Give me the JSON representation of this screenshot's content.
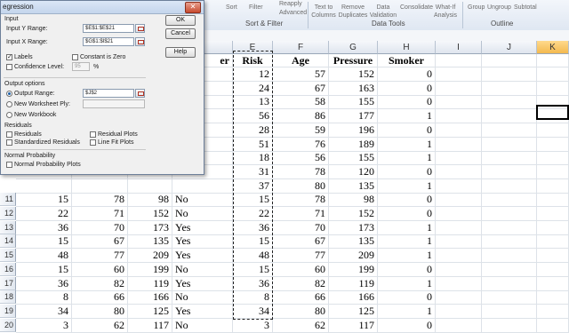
{
  "ribbon": {
    "items": [
      "Sort",
      "Filter",
      "Reapply",
      "Advanced",
      "Text to Columns",
      "Remove Duplicates",
      "Data Validation",
      "Consolidate",
      "What-If Analysis",
      "Group",
      "Ungroup",
      "Subtotal"
    ],
    "groups": [
      "Sort & Filter",
      "Data Tools",
      "Outline"
    ]
  },
  "columns": [
    "E",
    "F",
    "G",
    "H",
    "I",
    "J",
    "K"
  ],
  "rows": [
    {
      "n": "",
      "a": "",
      "b": "",
      "c": "",
      "d": "",
      "e": "12",
      "f": "57",
      "g": "152",
      "h": "0"
    },
    {
      "n": "",
      "a": "",
      "b": "",
      "c": "",
      "d": "",
      "e": "24",
      "f": "67",
      "g": "163",
      "h": "0"
    },
    {
      "n": "",
      "a": "",
      "b": "",
      "c": "",
      "d": "",
      "e": "13",
      "f": "58",
      "g": "155",
      "h": "0"
    },
    {
      "n": "",
      "a": "",
      "b": "",
      "c": "",
      "d": "",
      "e": "56",
      "f": "86",
      "g": "177",
      "h": "1"
    },
    {
      "n": "",
      "a": "",
      "b": "",
      "c": "",
      "d": "",
      "e": "28",
      "f": "59",
      "g": "196",
      "h": "0"
    },
    {
      "n": "",
      "a": "",
      "b": "",
      "c": "",
      "d": "",
      "e": "51",
      "f": "76",
      "g": "189",
      "h": "1"
    },
    {
      "n": "",
      "a": "",
      "b": "",
      "c": "",
      "d": "",
      "e": "18",
      "f": "56",
      "g": "155",
      "h": "1"
    },
    {
      "n": "",
      "a": "",
      "b": "",
      "c": "",
      "d": "",
      "e": "31",
      "f": "78",
      "g": "120",
      "h": "0"
    },
    {
      "n": "",
      "a": "",
      "b": "",
      "c": "",
      "d": "",
      "e": "37",
      "f": "80",
      "g": "135",
      "h": "1"
    },
    {
      "n": "11",
      "a": "15",
      "b": "78",
      "c": "98",
      "d": "No",
      "e": "15",
      "f": "78",
      "g": "98",
      "h": "0"
    },
    {
      "n": "12",
      "a": "22",
      "b": "71",
      "c": "152",
      "d": "No",
      "e": "22",
      "f": "71",
      "g": "152",
      "h": "0"
    },
    {
      "n": "13",
      "a": "36",
      "b": "70",
      "c": "173",
      "d": "Yes",
      "e": "36",
      "f": "70",
      "g": "173",
      "h": "1"
    },
    {
      "n": "14",
      "a": "15",
      "b": "67",
      "c": "135",
      "d": "Yes",
      "e": "15",
      "f": "67",
      "g": "135",
      "h": "1"
    },
    {
      "n": "15",
      "a": "48",
      "b": "77",
      "c": "209",
      "d": "Yes",
      "e": "48",
      "f": "77",
      "g": "209",
      "h": "1"
    },
    {
      "n": "16",
      "a": "15",
      "b": "60",
      "c": "199",
      "d": "No",
      "e": "15",
      "f": "60",
      "g": "199",
      "h": "0"
    },
    {
      "n": "17",
      "a": "36",
      "b": "82",
      "c": "119",
      "d": "Yes",
      "e": "36",
      "f": "82",
      "g": "119",
      "h": "1"
    },
    {
      "n": "18",
      "a": "8",
      "b": "66",
      "c": "166",
      "d": "No",
      "e": "8",
      "f": "66",
      "g": "166",
      "h": "0"
    },
    {
      "n": "19",
      "a": "34",
      "b": "80",
      "c": "125",
      "d": "Yes",
      "e": "34",
      "f": "80",
      "g": "125",
      "h": "1"
    },
    {
      "n": "20",
      "a": "3",
      "b": "62",
      "c": "117",
      "d": "No",
      "e": "3",
      "f": "62",
      "g": "117",
      "h": "0"
    }
  ],
  "headers": {
    "d_partial": "er",
    "e": "Risk",
    "f": "Age",
    "g": "Pressure",
    "h": "Smoker"
  },
  "dialog": {
    "title": "egression",
    "ok": "OK",
    "cancel": "Cancel",
    "help": "Help",
    "input_section": "Input",
    "input_y_label": "Input Y Range:",
    "input_y_value": "$E$1:$E$21",
    "input_x_label": "Input X Range:",
    "input_x_value": "$G$1:$I$21",
    "labels": "Labels",
    "constant_zero": "Constant is Zero",
    "confidence": "Confidence Level:",
    "confidence_value": "95",
    "percent": "%",
    "output_section": "Output options",
    "output_range": "Output Range:",
    "output_range_value": "$J$2",
    "new_ply": "New Worksheet Ply:",
    "new_workbook": "New Workbook",
    "residuals_section": "Residuals",
    "residuals": "Residuals",
    "std_residuals": "Standardized Residuals",
    "residual_plots": "Residual Plots",
    "line_fit": "Line Fit Plots",
    "normal_section": "Normal Probability",
    "normal_plots": "Normal Probability Plots"
  }
}
